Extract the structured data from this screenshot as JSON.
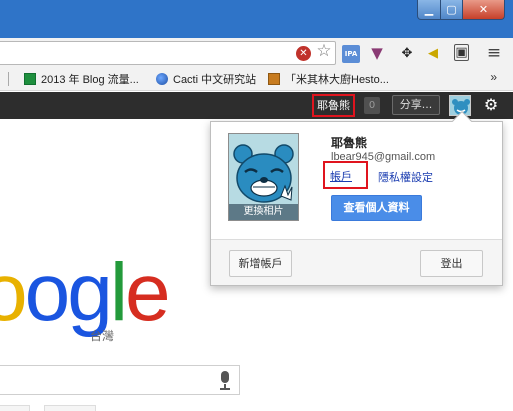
{
  "window": {
    "minimize_glyph": "▁",
    "maximize_glyph": "▢",
    "close_glyph": "✕",
    "title_bar_color": "#2f74c8"
  },
  "toolbar": {
    "extension_icons": [
      "block-icon",
      "star-icon",
      "ipa-icon",
      "thumb-down-icon",
      "cursor-icon",
      "plug-icon",
      "screenshot-icon",
      "menu-icon"
    ],
    "ipa_label": "IPA",
    "menu_glyph": "≡"
  },
  "bookmarks": {
    "items": [
      {
        "label": "2013 年 Blog 流量..."
      },
      {
        "label": "Cacti 中文研究站"
      },
      {
        "label": "「米其林大廚Hesto..."
      }
    ],
    "more_glyph": "»"
  },
  "gbar": {
    "user_name": "耶魯熊",
    "notification_count": "0",
    "share_label": "分享...",
    "bar_color": "#2d2d2d",
    "highlight_color": "#e0141e"
  },
  "account_popup": {
    "name": "耶魯熊",
    "email": "lbear945@gmail.com",
    "account_link": "帳戶",
    "privacy_link": "隱私權設定",
    "view_profile_button": "查看個人資料",
    "change_photo_label": "更換相片",
    "add_account_button": "新增帳戶",
    "sign_out_button": "登出",
    "primary_button_color": "#4a8de8"
  },
  "google": {
    "logo_letters": [
      "o",
      "o",
      "g",
      "l",
      "e"
    ],
    "logo_colors": [
      "#e8b100",
      "#1a55e0",
      "#1a55e0",
      "#239a3b",
      "#d62d20"
    ],
    "region_label": "台灣"
  }
}
